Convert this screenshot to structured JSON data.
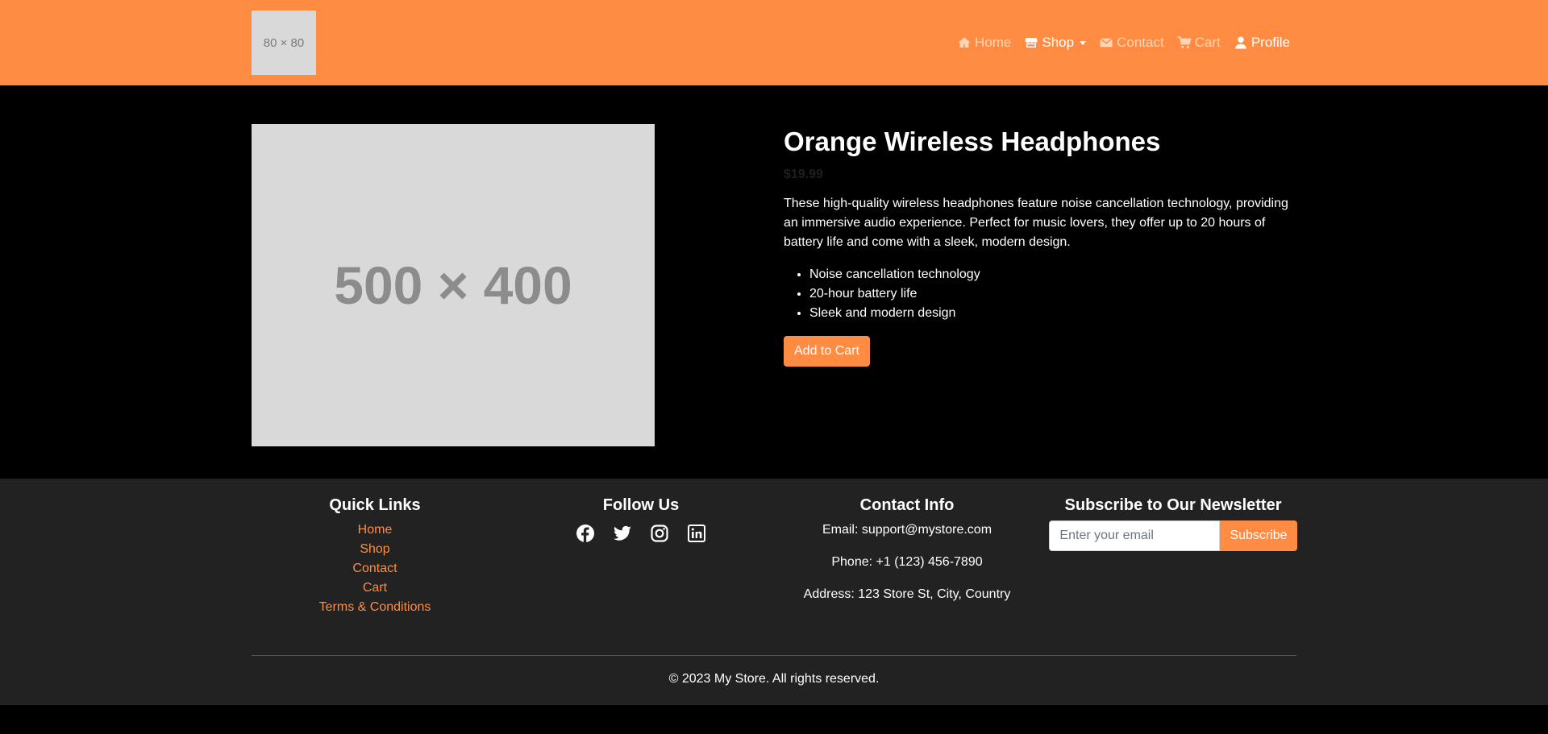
{
  "header": {
    "logo_text": "80 × 80",
    "nav": {
      "home": "Home",
      "shop": "Shop",
      "contact": "Contact",
      "cart": "Cart",
      "profile": "Profile"
    }
  },
  "product": {
    "image_text": "500 × 400",
    "title": "Orange Wireless Headphones",
    "price": "$19.99",
    "description": "These high-quality wireless headphones feature noise cancellation technology, providing an immersive audio experience. Perfect for music lovers, they offer up to 20 hours of battery life and come with a sleek, modern design.",
    "features": [
      "Noise cancellation technology",
      "20-hour battery life",
      "Sleek and modern design"
    ],
    "add_to_cart_label": "Add to Cart"
  },
  "footer": {
    "quick_links": {
      "heading": "Quick Links",
      "items": [
        "Home",
        "Shop",
        "Contact",
        "Cart",
        "Terms & Conditions"
      ]
    },
    "follow_us": {
      "heading": "Follow Us",
      "icons": [
        "facebook-icon",
        "twitter-icon",
        "instagram-icon",
        "linkedin-icon"
      ]
    },
    "contact_info": {
      "heading": "Contact Info",
      "email": "Email: support@mystore.com",
      "phone": "Phone: +1 (123) 456-7890",
      "address": "Address: 123 Store St, City, Country"
    },
    "newsletter": {
      "heading": "Subscribe to Our Newsletter",
      "placeholder": "Enter your email",
      "button_label": "Subscribe"
    },
    "copyright": "© 2023 My Store. All rights reserved."
  },
  "colors": {
    "accent": "#ff8c42",
    "footer_bg": "#222222",
    "main_bg": "#000000"
  }
}
